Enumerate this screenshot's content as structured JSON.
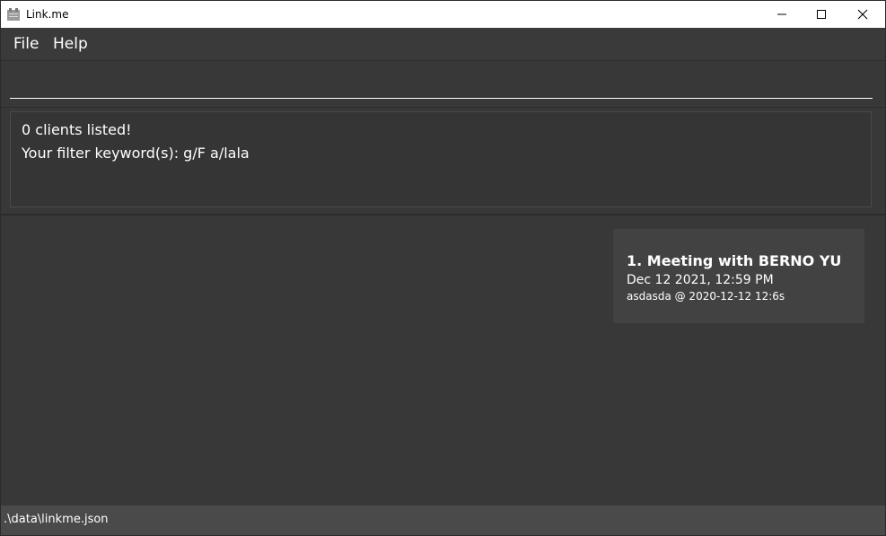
{
  "window": {
    "title": "Link.me",
    "icon": "app-icon"
  },
  "menu": {
    "file_label": "File",
    "help_label": "Help"
  },
  "command": {
    "value": "",
    "placeholder": ""
  },
  "result": {
    "line1": "0 clients listed!",
    "line2": "Your filter keyword(s): g/F a/lala"
  },
  "meetings": [
    {
      "title": "1.  Meeting with BERNO YU",
      "date": "Dec 12 2021, 12:59 PM",
      "detail": "asdasda @ 2020-12-12 12:6s"
    }
  ],
  "status": {
    "path": ".\\data\\linkme.json"
  },
  "colors": {
    "background": "#383838",
    "card": "#424242",
    "statusbar": "#4a4a4a",
    "text": "#ffffff"
  }
}
